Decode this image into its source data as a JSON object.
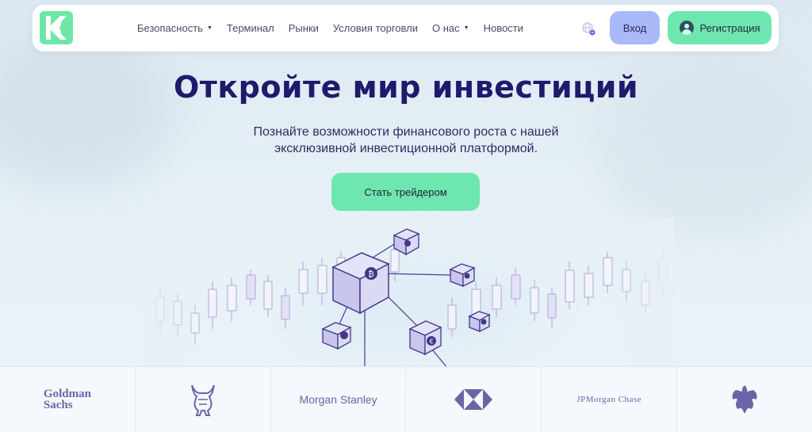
{
  "header": {
    "nav": [
      {
        "label": "Безопасность",
        "has_dropdown": true
      },
      {
        "label": "Терминал",
        "has_dropdown": false
      },
      {
        "label": "Рынки",
        "has_dropdown": false
      },
      {
        "label": "Условия торговли",
        "has_dropdown": false
      },
      {
        "label": "О нас",
        "has_dropdown": true
      },
      {
        "label": "Новости",
        "has_dropdown": false
      }
    ],
    "login_label": "Вход",
    "register_label": "Регистрация"
  },
  "hero": {
    "title": "Откройте мир инвестиций",
    "subtitle_line1": "Познайте возможности финансового роста с нашей",
    "subtitle_line2": "эксклюзивной инвестиционной платформой.",
    "cta_label": "Стать трейдером"
  },
  "partners": {
    "goldman_line1": "Goldman",
    "goldman_line2": "Sachs",
    "morgan_stanley": "Morgan Stanley",
    "jpmorgan": "JPMorgan Chase"
  },
  "colors": {
    "accent_green": "#6ee6b0",
    "accent_blue": "#a9b8f8",
    "title": "#1f1a6b"
  },
  "icons": [
    "logo-icon",
    "globe-icon",
    "user-avatar-icon",
    "bitcoin-icon",
    "euro-icon",
    "apple-icon",
    "lock-icon",
    "bull-logo-icon",
    "hsbc-logo-icon",
    "eagle-logo-icon"
  ]
}
